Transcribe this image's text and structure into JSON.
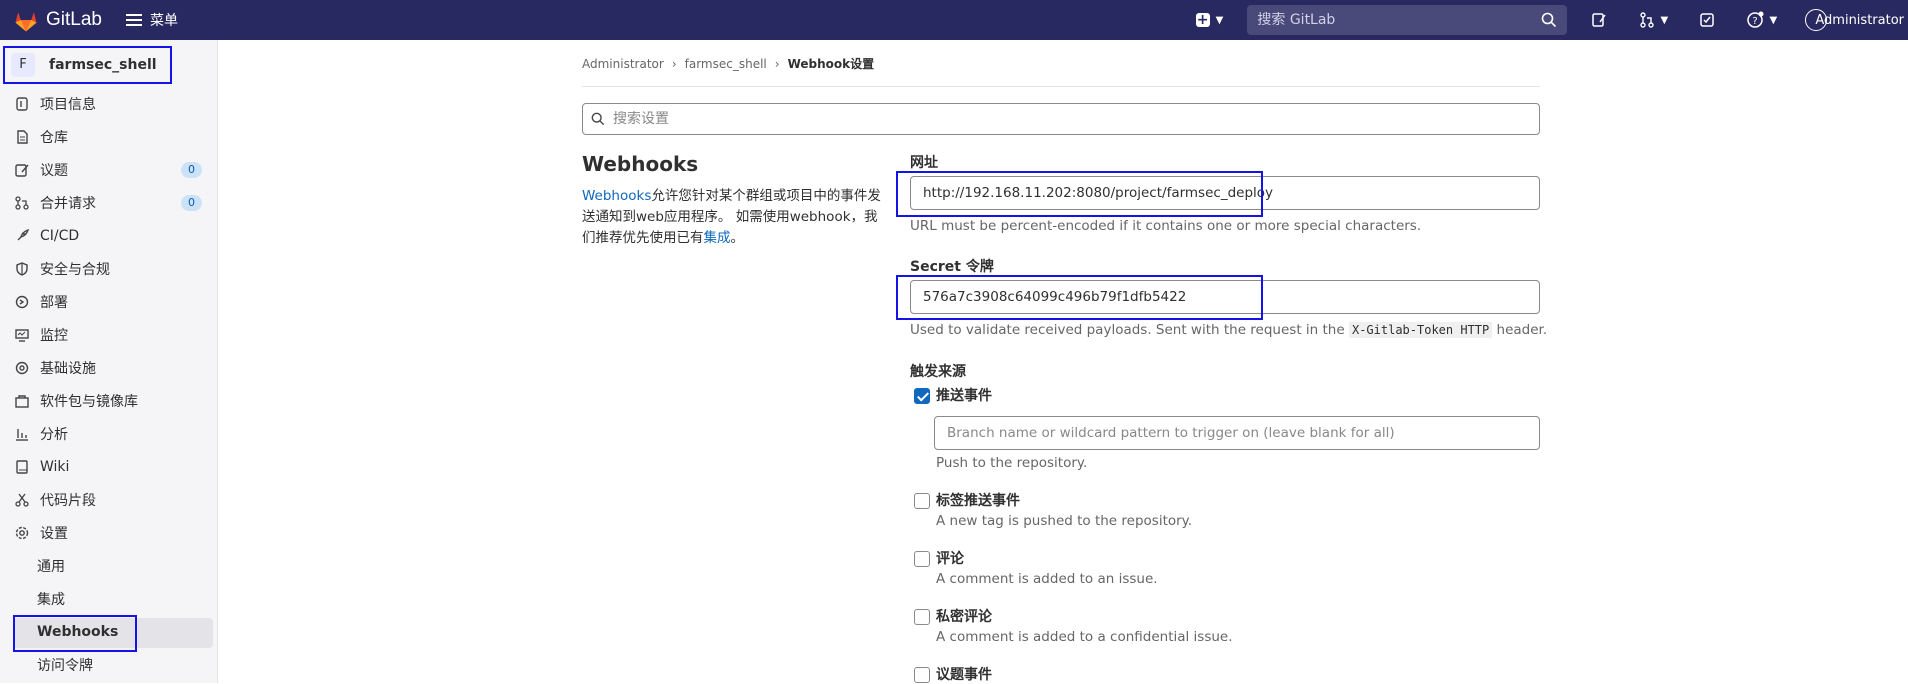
{
  "topbar": {
    "brand": "GitLab",
    "menu_label": "菜单",
    "search_placeholder": "搜索 GitLab",
    "user_label": "Administrator"
  },
  "sidebar": {
    "project_initial": "F",
    "project_name": "farmsec_shell",
    "items": [
      {
        "label": "项目信息",
        "icon": "info-icon"
      },
      {
        "label": "仓库",
        "icon": "doc-icon"
      },
      {
        "label": "议题",
        "icon": "issues-icon",
        "badge": "0"
      },
      {
        "label": "合并请求",
        "icon": "merge-icon",
        "badge": "0"
      },
      {
        "label": "CI/CD",
        "icon": "rocket-icon"
      },
      {
        "label": "安全与合规",
        "icon": "shield-icon"
      },
      {
        "label": "部署",
        "icon": "deploy-icon"
      },
      {
        "label": "监控",
        "icon": "monitor-icon"
      },
      {
        "label": "基础设施",
        "icon": "cloud-icon"
      },
      {
        "label": "软件包与镜像库",
        "icon": "package-icon"
      },
      {
        "label": "分析",
        "icon": "chart-icon"
      },
      {
        "label": "Wiki",
        "icon": "book-icon"
      },
      {
        "label": "代码片段",
        "icon": "scissors-icon"
      },
      {
        "label": "设置",
        "icon": "gear-icon"
      }
    ],
    "sub_items": [
      "通用",
      "集成",
      "Webhooks",
      "访问令牌"
    ]
  },
  "breadcrumb": {
    "root": "Administrator",
    "project": "farmsec_shell",
    "current": "Webhook设置"
  },
  "settings_search_placeholder": "搜索设置",
  "webhooks": {
    "title": "Webhooks",
    "desc_link": "Webhooks",
    "desc_text": "允许您针对某个群组或项目中的事件发送通知到web应用程序。 如需使用webhook，我们推荐优先使用已有",
    "desc_link2": "集成",
    "desc_end": "。"
  },
  "form": {
    "url_label": "网址",
    "url_value": "http://192.168.11.202:8080/project/farmsec_deploy",
    "url_help": "URL must be percent-encoded if it contains one or more special characters.",
    "secret_label": "Secret 令牌",
    "secret_value": "576a7c3908c64099c496b79f1dfb5422",
    "secret_help_1": "Used to validate received payloads. Sent with the request in the",
    "secret_help_code": "X-Gitlab-Token HTTP",
    "secret_help_2": "header.",
    "trigger_label": "触发来源",
    "branch_placeholder": "Branch name or wildcard pattern to trigger on (leave blank for all)",
    "triggers": [
      {
        "label": "推送事件",
        "help": "Push to the repository.",
        "checked": true
      },
      {
        "label": "标签推送事件",
        "help": "A new tag is pushed to the repository.",
        "checked": false
      },
      {
        "label": "评论",
        "help": "A comment is added to an issue.",
        "checked": false
      },
      {
        "label": "私密评论",
        "help": "A comment is added to a confidential issue.",
        "checked": false
      },
      {
        "label": "议题事件",
        "help": "",
        "checked": false
      }
    ]
  }
}
